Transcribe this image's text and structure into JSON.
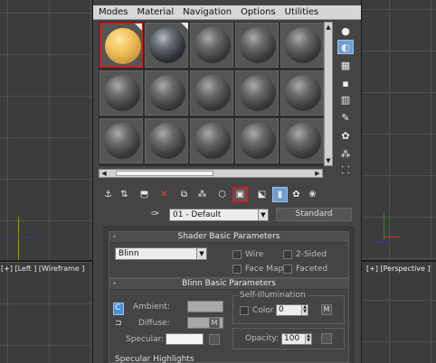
{
  "viewports": {
    "left_label": "[+] [Left ] [Wireframe ]",
    "right_label": "[+] [Perspective ]"
  },
  "menu": [
    "Modes",
    "Material",
    "Navigation",
    "Options",
    "Utilities"
  ],
  "material_editor": {
    "material_name": "01 - Default",
    "material_type": "Standard",
    "slots_selected_index": 0,
    "shader_rollout": {
      "title": "Shader Basic Parameters",
      "shader": "Blinn",
      "options": [
        "Wire",
        "2-Sided",
        "Face Map",
        "Faceted"
      ]
    },
    "blinn_rollout": {
      "title": "Blinn Basic Parameters",
      "self_illum_group": "Self-Illumination",
      "ambient_label": "Ambient:",
      "diffuse_label": "Diffuse:",
      "specular_label": "Specular:",
      "map_button": "M",
      "color_label": "Color",
      "color_value": "0",
      "opacity_label": "Opacity:",
      "opacity_value": "100",
      "lock_letter": "C",
      "next_heading": "Specular Highlights"
    }
  }
}
